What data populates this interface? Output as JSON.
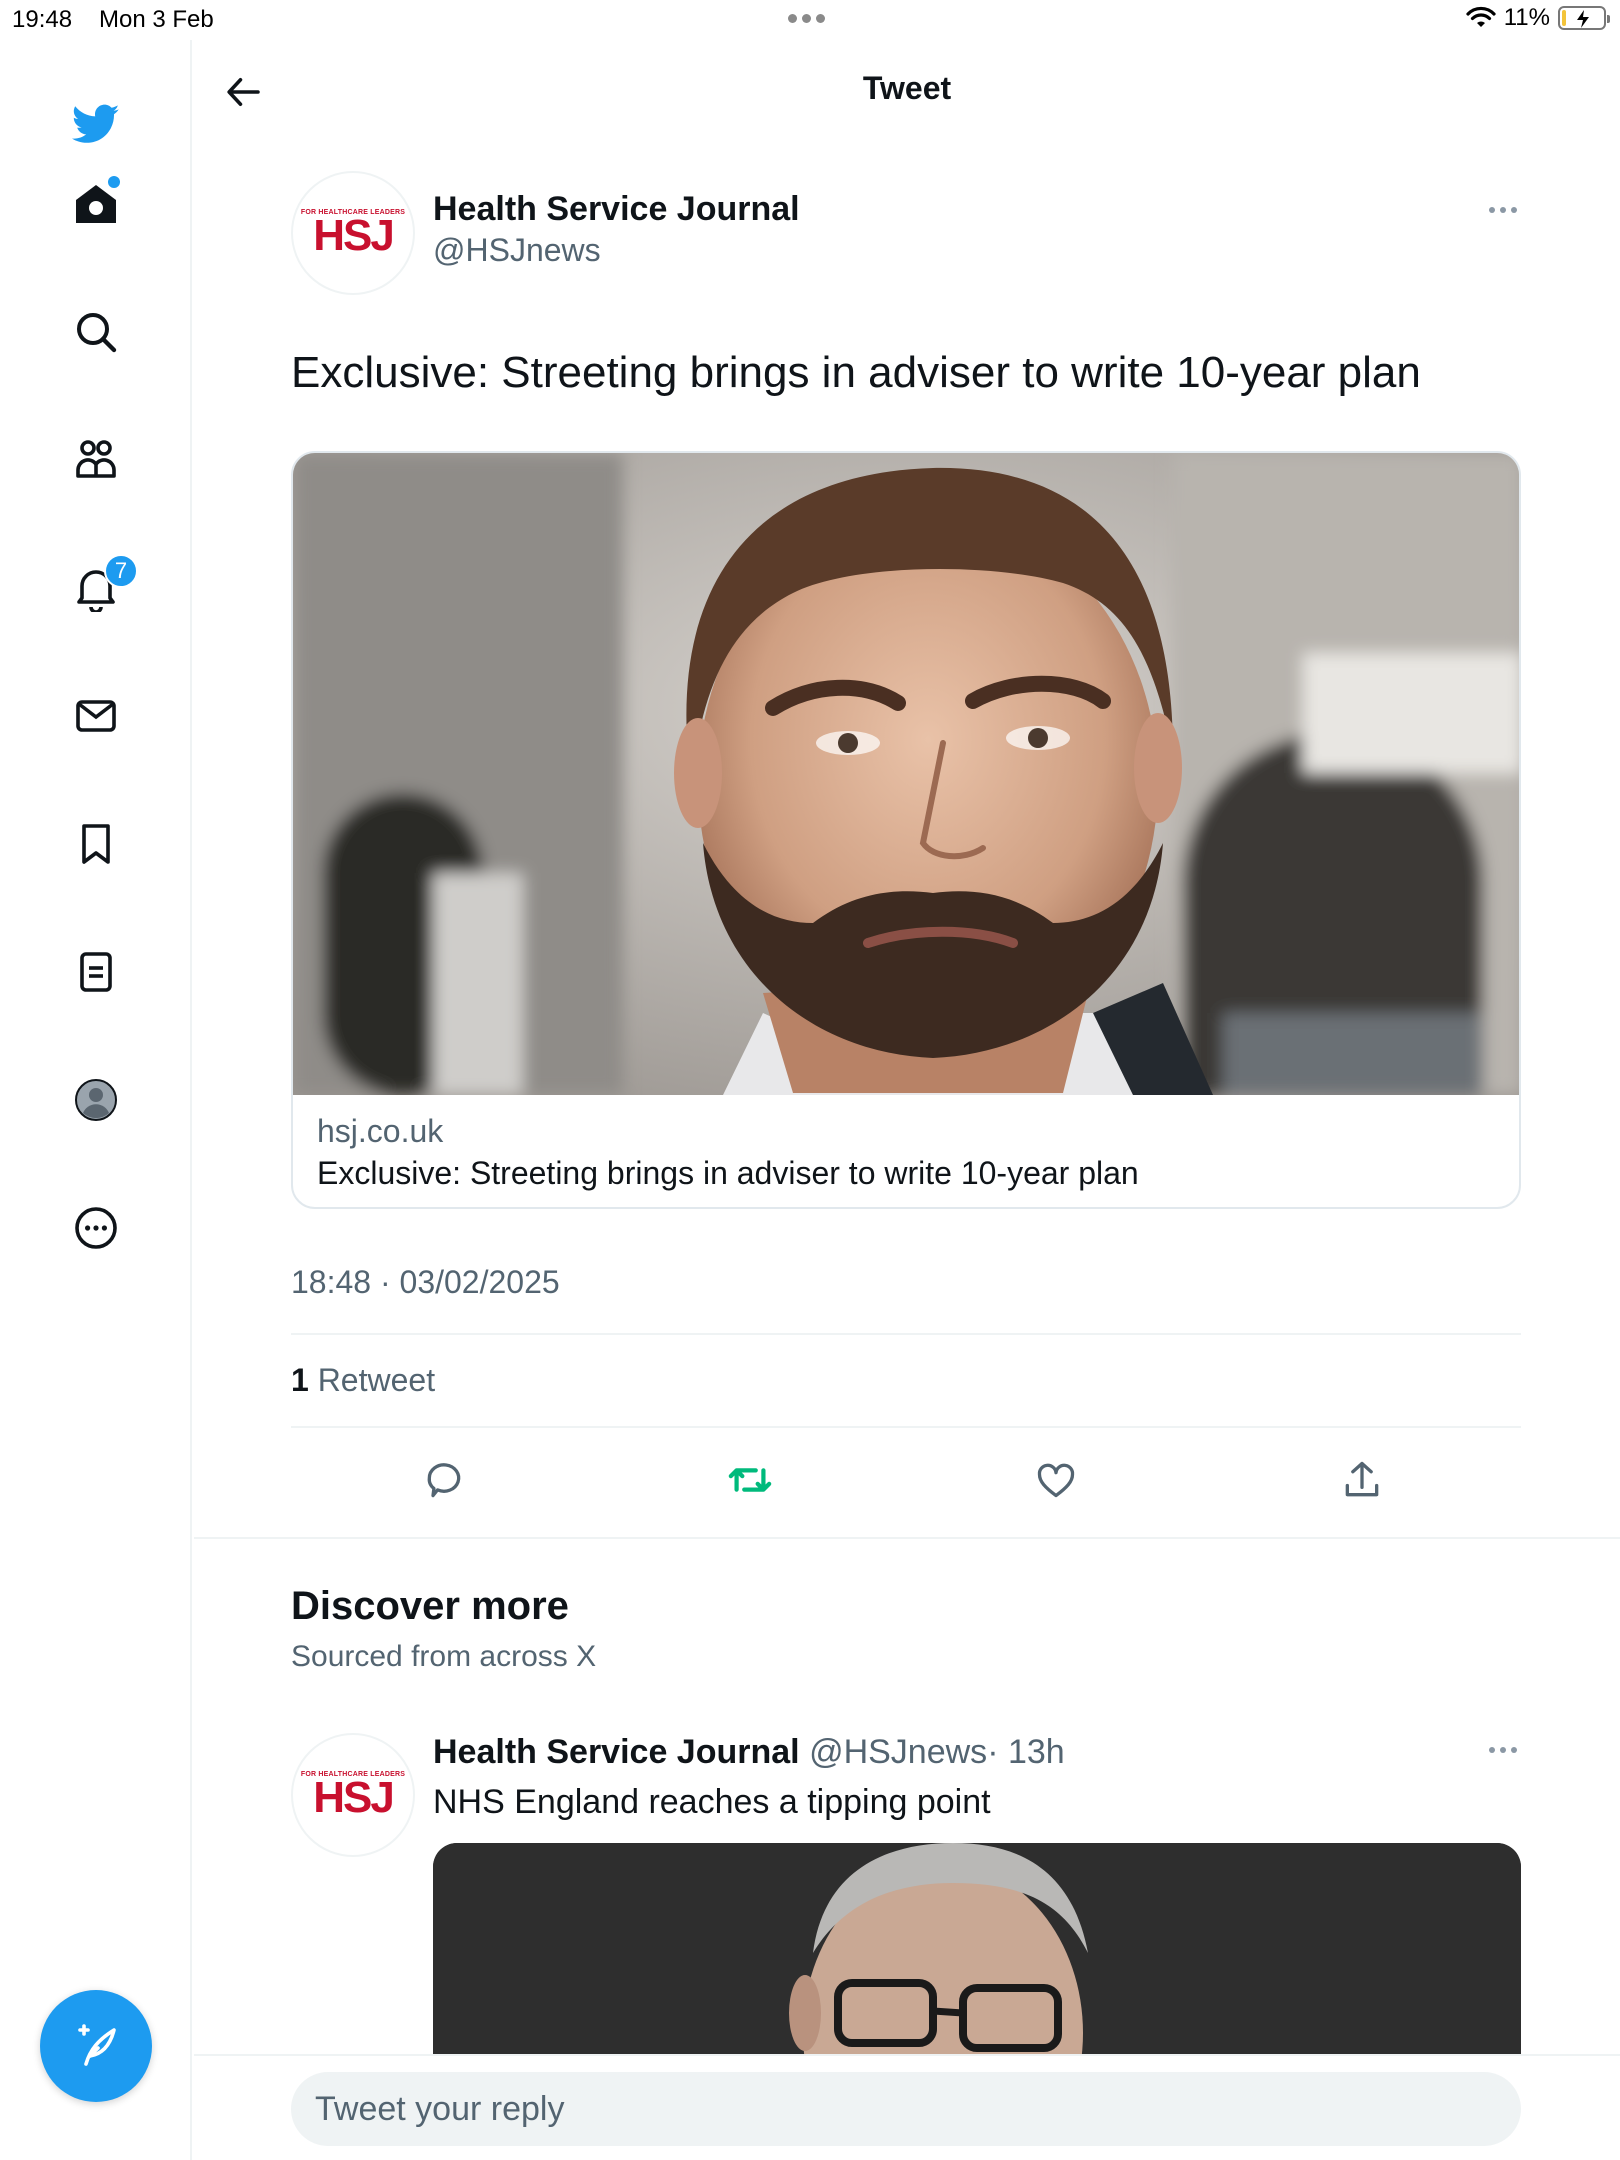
{
  "status_bar": {
    "time": "19:48",
    "date": "Mon 3 Feb",
    "battery": "11%",
    "battery_level": 0.11
  },
  "sidebar": {
    "items": [
      {
        "name": "home",
        "icon": "home-icon",
        "has_dot": true
      },
      {
        "name": "explore",
        "icon": "search-icon"
      },
      {
        "name": "communities",
        "icon": "communities-icon"
      },
      {
        "name": "notifications",
        "icon": "bell-icon",
        "badge": "7"
      },
      {
        "name": "messages",
        "icon": "mail-icon"
      },
      {
        "name": "bookmarks",
        "icon": "bookmark-icon"
      },
      {
        "name": "lists",
        "icon": "list-icon"
      },
      {
        "name": "profile",
        "icon": "profile-avatar-icon"
      },
      {
        "name": "more",
        "icon": "more-circle-icon"
      }
    ],
    "notification_badge": "7"
  },
  "header": {
    "title": "Tweet"
  },
  "tweet": {
    "author_name": "Health Service Journal",
    "handle": "@HSJnews",
    "avatar_logo": "HSJ",
    "avatar_tagline": "FOR HEALTHCARE LEADERS",
    "text": "Exclusive: Streeting brings in adviser to write 10-year plan",
    "card": {
      "domain": "hsj.co.uk",
      "title": "Exclusive: Streeting brings in adviser to write 10-year plan"
    },
    "timestamp": "18:48 · 03/02/2025",
    "retweet_count": "1",
    "retweet_label": "Retweet"
  },
  "discover": {
    "title": "Discover more",
    "subtitle": "Sourced from across X",
    "tweet": {
      "author_name": "Health Service Journal",
      "handle": "@HSJnews",
      "time": "· 13h",
      "text": "NHS England reaches a tipping point"
    }
  },
  "reply": {
    "placeholder": "Tweet your reply"
  },
  "colors": {
    "accent": "#1d9bf0",
    "retweet_active": "#00ba7c",
    "hsj_red": "#c8102e",
    "muted_text": "#536471"
  }
}
